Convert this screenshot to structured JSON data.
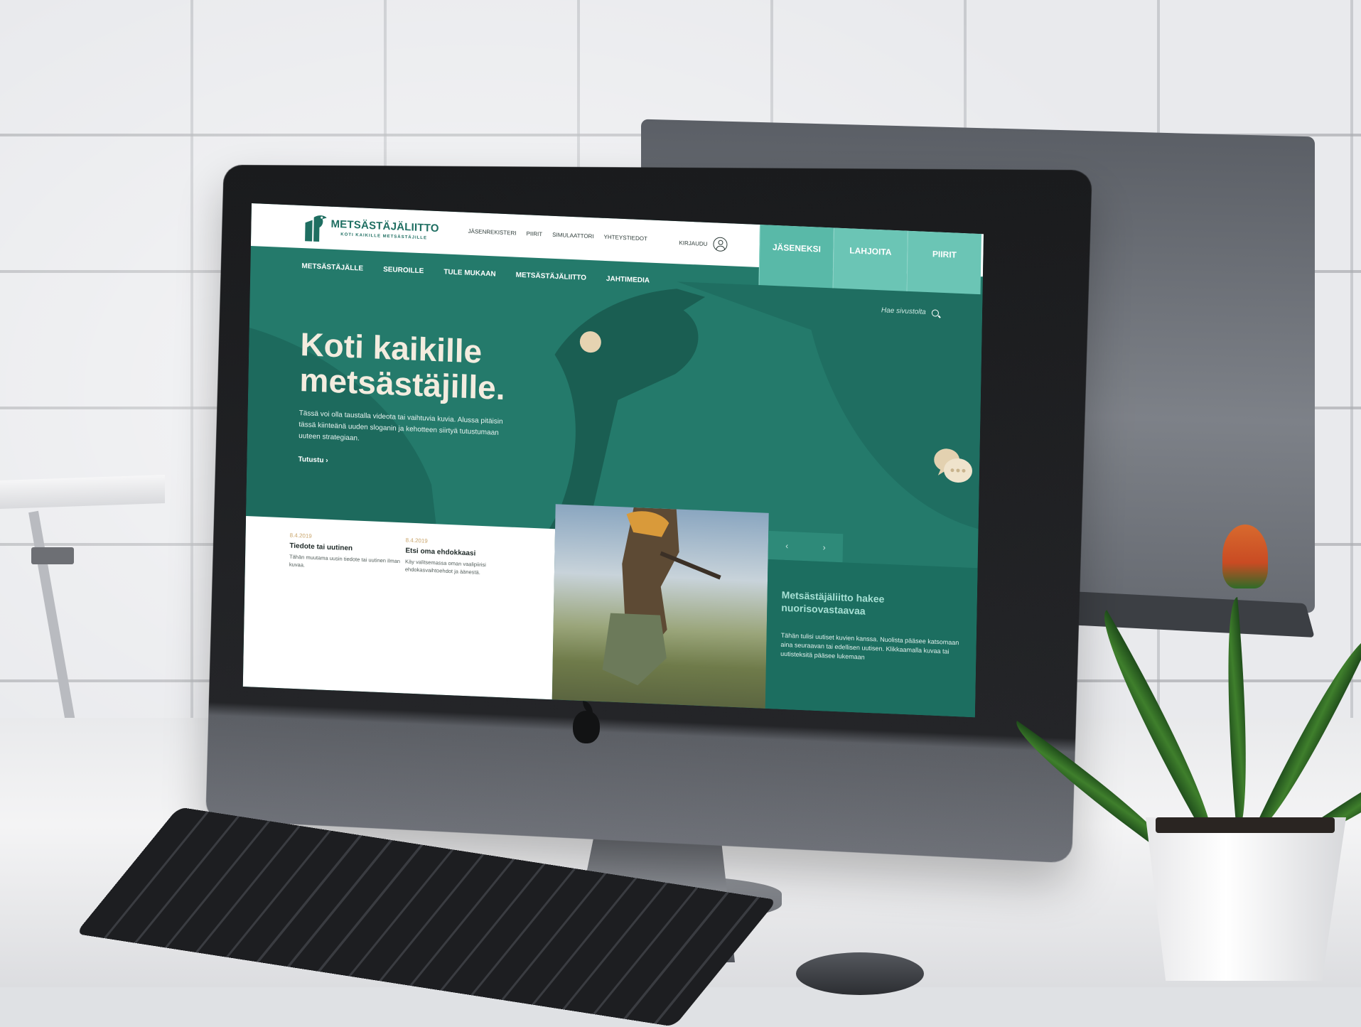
{
  "site": {
    "logo": {
      "title": "METSÄSTÄJÄLIITTO",
      "tagline": "KOTI KAIKILLE METSÄSTÄJILLE"
    },
    "utility_nav": [
      "JÄSENREKISTERI",
      "PIIRIT",
      "SIMULAATTORI",
      "YHTEYSTIEDOT"
    ],
    "login_label": "KIRJAUDU",
    "cta_tabs": [
      "JÄSENEKSI",
      "LAHJOITA",
      "PIIRIT"
    ],
    "main_nav": [
      "METSÄSTÄJÄLLE",
      "SEUROILLE",
      "TULE MUKAAN",
      "METSÄSTÄJÄLIITTO",
      "JAHTIMEDIA"
    ],
    "search_placeholder": "Hae sivustolta",
    "hero": {
      "title_line1": "Koti kaikille",
      "title_line2": "metsästäjille.",
      "text": "Tässä voi olla taustalla videota tai vaihtuvia kuvia. Alussa pitäisin tässä kiinteänä uuden sloganin ja kehotteen siirtyä tutustumaan uuteen strategiaan.",
      "link": "Tutustu ›"
    },
    "news": [
      {
        "date": "8.4.2019",
        "title": "Tiedote tai uutinen",
        "text": "Tähän muutama uusin tiedote tai uutinen ilman kuvaa."
      },
      {
        "date": "8.4.2019",
        "title": "Etsi oma ehdokkaasi",
        "text": "Käy valitsemassa oman vaalipiirisi ehdokasvaihtoehdot ja äänestä."
      }
    ],
    "carousel": {
      "prev": "‹",
      "next": "›"
    },
    "feature": {
      "title": "Metsästäjäliitto hakee nuorisovastaavaa",
      "text": "Tähän tulisi uutiset kuvien kanssa. Nuolista pääsee katsomaan aina seuraavan tai edellisen uutisen. Klikkaamalla kuvaa tai uutisteksitä pääsee lukemaan"
    }
  },
  "colors": {
    "primary_green": "#247a6b",
    "dark_green": "#1c6e60",
    "light_teal": "#6bc5b5",
    "cream": "#f3ecdf",
    "gold": "#c9a46a"
  }
}
